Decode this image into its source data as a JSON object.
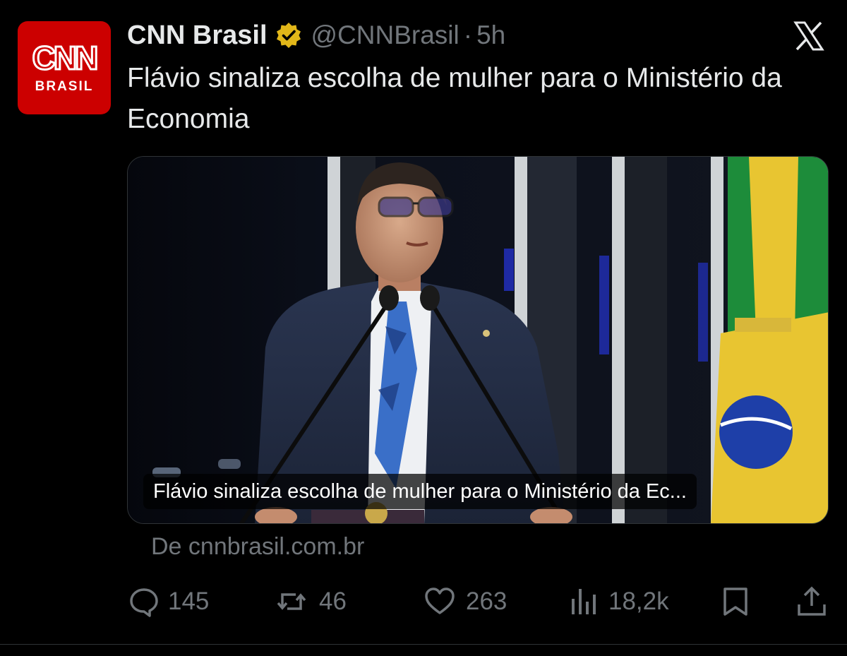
{
  "author": {
    "name": "CNN Brasil",
    "handle": "@CNNBrasil",
    "separator": "·",
    "time": "5h",
    "avatar_text": "BRASIL",
    "avatar_logo_text": "CNN",
    "verified_badge": "gold-verified-icon"
  },
  "platform_logo": "x-logo-icon",
  "tweet": {
    "text": "Flávio sinaliza escolha de mulher para o Ministério da Economia"
  },
  "card": {
    "title": "Flávio sinaliza escolha de mulher para o Ministério da Ec...",
    "source": "De cnnbrasil.com.br"
  },
  "actions": {
    "replies": "145",
    "reposts": "46",
    "likes": "263",
    "views": "18,2k"
  },
  "colors": {
    "background": "#000000",
    "text_primary": "#e7e9ea",
    "text_secondary": "#71767b",
    "brand_red": "#cc0000",
    "verified_gold": "#e2b719"
  }
}
